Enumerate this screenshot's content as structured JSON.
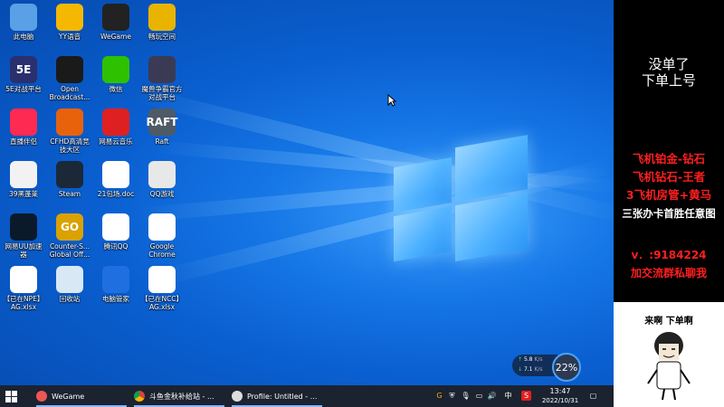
{
  "desktop": {
    "icons": [
      {
        "label": "此电脑",
        "icon": "computer-icon",
        "color": "#5aa0e6"
      },
      {
        "label": "YY语音",
        "icon": "yy-voice-icon",
        "color": "#f5b800"
      },
      {
        "label": "WeGame",
        "icon": "wegame-icon",
        "color": "#222222"
      },
      {
        "label": "畅玩空间",
        "icon": "game-space-icon",
        "color": "#e8b400"
      },
      {
        "label": "5E对战平台",
        "icon": "5e-platform-icon",
        "color": "#2a2f6e",
        "text": "5E"
      },
      {
        "label": "Open\nBroadcast...",
        "icon": "obs-icon",
        "color": "#1a1a1a"
      },
      {
        "label": "微信",
        "icon": "wechat-icon",
        "color": "#2dc100"
      },
      {
        "label": "魔兽争霸官方\n对战平台",
        "icon": "warcraft-icon",
        "color": "#3a3a55"
      },
      {
        "label": "直播伴侣",
        "icon": "live-companion-icon",
        "color": "#ff2a52"
      },
      {
        "label": "CFHD高清竞\n技大区",
        "icon": "cfhd-icon",
        "color": "#e8620c"
      },
      {
        "label": "网易云音乐",
        "icon": "netease-music-icon",
        "color": "#e02020"
      },
      {
        "label": "Raft",
        "icon": "raft-icon",
        "color": "#4e5a66",
        "text": "RAFT"
      },
      {
        "label": "39黑蓬莱",
        "icon": "document-icon",
        "color": "#f2f2f2"
      },
      {
        "label": "Steam",
        "icon": "steam-icon",
        "color": "#1b2838"
      },
      {
        "label": "21包场.doc",
        "icon": "word-doc-icon",
        "color": "#ffffff"
      },
      {
        "label": "QQ游戏",
        "icon": "qq-game-icon",
        "color": "#e8e8e8"
      },
      {
        "label": "网易UU加速\n器",
        "icon": "uu-accelerator-icon",
        "color": "#0b1a2a"
      },
      {
        "label": "Counter-S...\nGlobal Off...",
        "icon": "csgo-icon",
        "color": "#d9a200",
        "text": "GO"
      },
      {
        "label": "腾讯QQ",
        "icon": "qq-icon",
        "color": "#ffffff"
      },
      {
        "label": "Google\nChrome",
        "icon": "chrome-icon",
        "color": "#ffffff"
      },
      {
        "label": "【已在NPE】\nAG.xlsx",
        "icon": "excel-icon",
        "color": "#ffffff"
      },
      {
        "label": "回收站",
        "icon": "recycle-bin-icon",
        "color": "#d8e8f4"
      },
      {
        "label": "电脑管家",
        "icon": "pc-manager-icon",
        "color": "#1f6fe0"
      },
      {
        "label": "【已在NCC】\nAG.xlsx",
        "icon": "excel-icon",
        "color": "#ffffff"
      }
    ],
    "net_widget": {
      "upload": "5.8",
      "upload_unit": "K/s",
      "download": "7.1",
      "download_unit": "K/s",
      "percent": "22%"
    }
  },
  "taskbar": {
    "items": [
      {
        "label": "WeGame",
        "icon": "wegame-icon"
      },
      {
        "label": "斗鱼金秋补给站 - ...",
        "icon": "chrome-icon"
      },
      {
        "label": "Profile: Untitled - ...",
        "icon": "obs-icon"
      }
    ],
    "ime": "中",
    "clock_time": "13:47",
    "clock_date": "2022/10/31"
  },
  "sidebar": {
    "line1": "没单了",
    "line2": "下单上号",
    "red_lines": [
      "飞机铂金-钻石",
      "飞机钻石-王者",
      "3飞机房管+黄马"
    ],
    "white_line": "三张办卡首胜任意图",
    "contact": "v．:9184224",
    "contact2": "加交流群私聊我",
    "meme_text": "来啊  下单啊"
  },
  "colors": {
    "accent_red": "#ff1f1f",
    "taskbar": "#1b2330",
    "desktop": "#0a5fd0"
  }
}
